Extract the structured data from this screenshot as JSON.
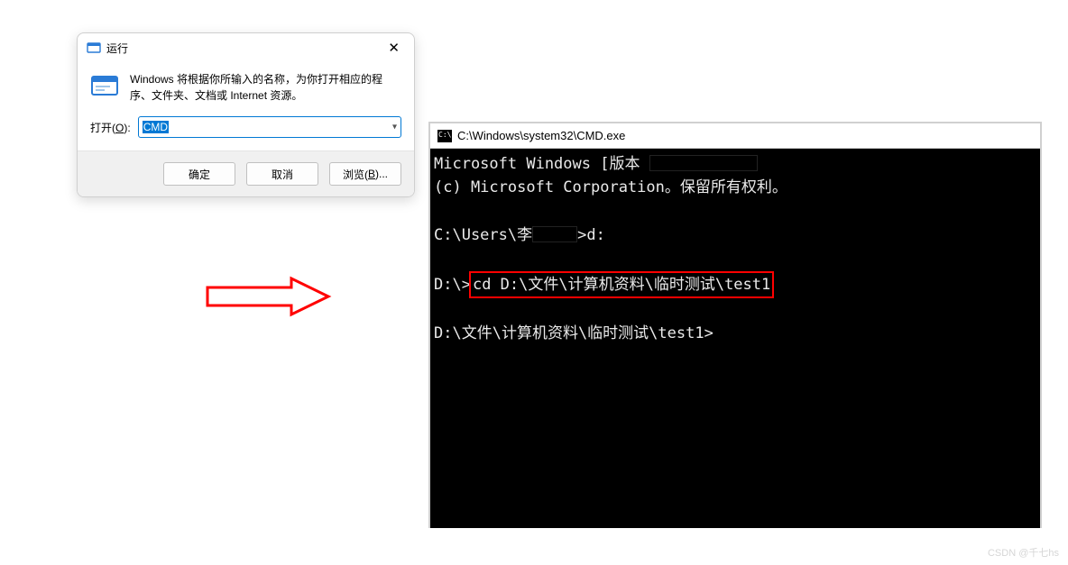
{
  "run_dialog": {
    "title": "运行",
    "description": "Windows 将根据你所输入的名称，为你打开相应的程序、文件夹、文档或 Internet 资源。",
    "open_label_prefix": "打开(",
    "open_label_hotkey": "O",
    "open_label_suffix": "):",
    "input_value": "CMD",
    "buttons": {
      "ok": "确定",
      "cancel": "取消",
      "browse_prefix": "浏览(",
      "browse_hotkey": "B",
      "browse_suffix": ")..."
    }
  },
  "cmd_window": {
    "titlebar": "C:\\Windows\\system32\\CMD.exe",
    "lines": {
      "l0": "Microsoft Windows [版本 ",
      "l1": "(c) Microsoft Corporation。保留所有权利。",
      "l2_prefix": "C:\\Users\\李",
      "l2_suffix": ">d:",
      "l3_prompt": "D:\\>",
      "l3_cmd": "cd D:\\文件\\计算机资料\\临时测试\\test1",
      "l4": "D:\\文件\\计算机资料\\临时测试\\test1>"
    }
  },
  "watermark": "CSDN @千七hs"
}
